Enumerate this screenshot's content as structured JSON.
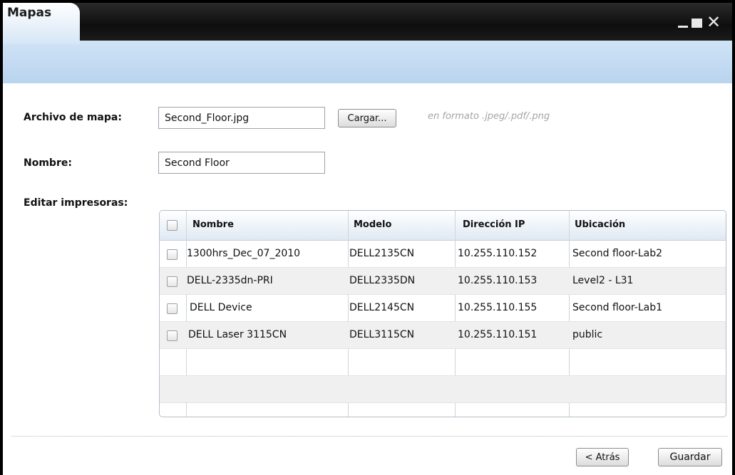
{
  "window": {
    "title": "Mapas"
  },
  "form": {
    "map_file_label": "Archivo de mapa:",
    "map_file_value": "Second_Floor.jpg",
    "upload_label": "Cargar...",
    "format_hint": "en formato .jpeg/.pdf/.png",
    "name_label": "Nombre:",
    "name_value": "Second Floor",
    "printers_label": "Editar impresoras:"
  },
  "table": {
    "headers": [
      "Nombre",
      "Modelo",
      "Dirección IP",
      "Ubicación"
    ],
    "rows": [
      [
        "1300hrs_Dec_07_2010",
        "DELL2135CN",
        "10.255.110.152",
        "Second floor-Lab2"
      ],
      [
        "DELL-2335dn-PRI",
        "DELL2335DN",
        "10.255.110.153",
        "Level2 - L31"
      ],
      [
        "DELL Device",
        "DELL2145CN",
        "10.255.110.155",
        "Second floor-Lab1"
      ],
      [
        "DELL Laser 3115CN",
        "DELL3115CN",
        "10.255.110.151",
        "public"
      ]
    ]
  },
  "footer": {
    "back_label": "< Atrás",
    "save_label": "Guardar"
  }
}
